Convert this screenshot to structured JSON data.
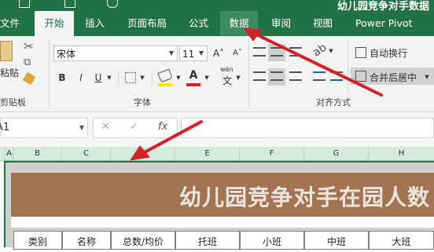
{
  "window": {
    "title_fragment": "幼儿园竞争对手数据"
  },
  "tabs": [
    {
      "label": "文件"
    },
    {
      "label": "开始"
    },
    {
      "label": "插入"
    },
    {
      "label": "页面布局"
    },
    {
      "label": "公式"
    },
    {
      "label": "数据"
    },
    {
      "label": "审阅"
    },
    {
      "label": "视图"
    },
    {
      "label": "Power Pivot"
    }
  ],
  "ribbon": {
    "clipboard": {
      "paste_label": "粘贴",
      "group_label": "剪贴板"
    },
    "font": {
      "font_name": "宋体",
      "font_size": "11",
      "bold": "B",
      "italic": "I",
      "underline": "U",
      "font_color_glyph": "A",
      "wen_glyph": "wén",
      "wen_char": "文",
      "grow_font": "A˄",
      "shrink_font": "A˅",
      "group_label": "字体"
    },
    "alignment": {
      "wrap_text": "自动换行",
      "merge_center": "合并后居中",
      "group_label": "对齐方式"
    }
  },
  "formula_bar": {
    "name_box": "A1",
    "cancel": "✕",
    "enter": "✓",
    "fx": "fx",
    "formula": ""
  },
  "columns": [
    "A",
    "B",
    "C",
    "D",
    "E",
    "F",
    "G",
    "H"
  ],
  "sheet": {
    "banner_title": "幼儿园竞争对手在园人数",
    "headers": [
      "类别",
      "名称",
      "总数/均价",
      "托班",
      "小班",
      "中班",
      "大班"
    ]
  },
  "colors": {
    "accent": "#217346",
    "banner": "#a27452",
    "arrow": "#d3212a"
  }
}
